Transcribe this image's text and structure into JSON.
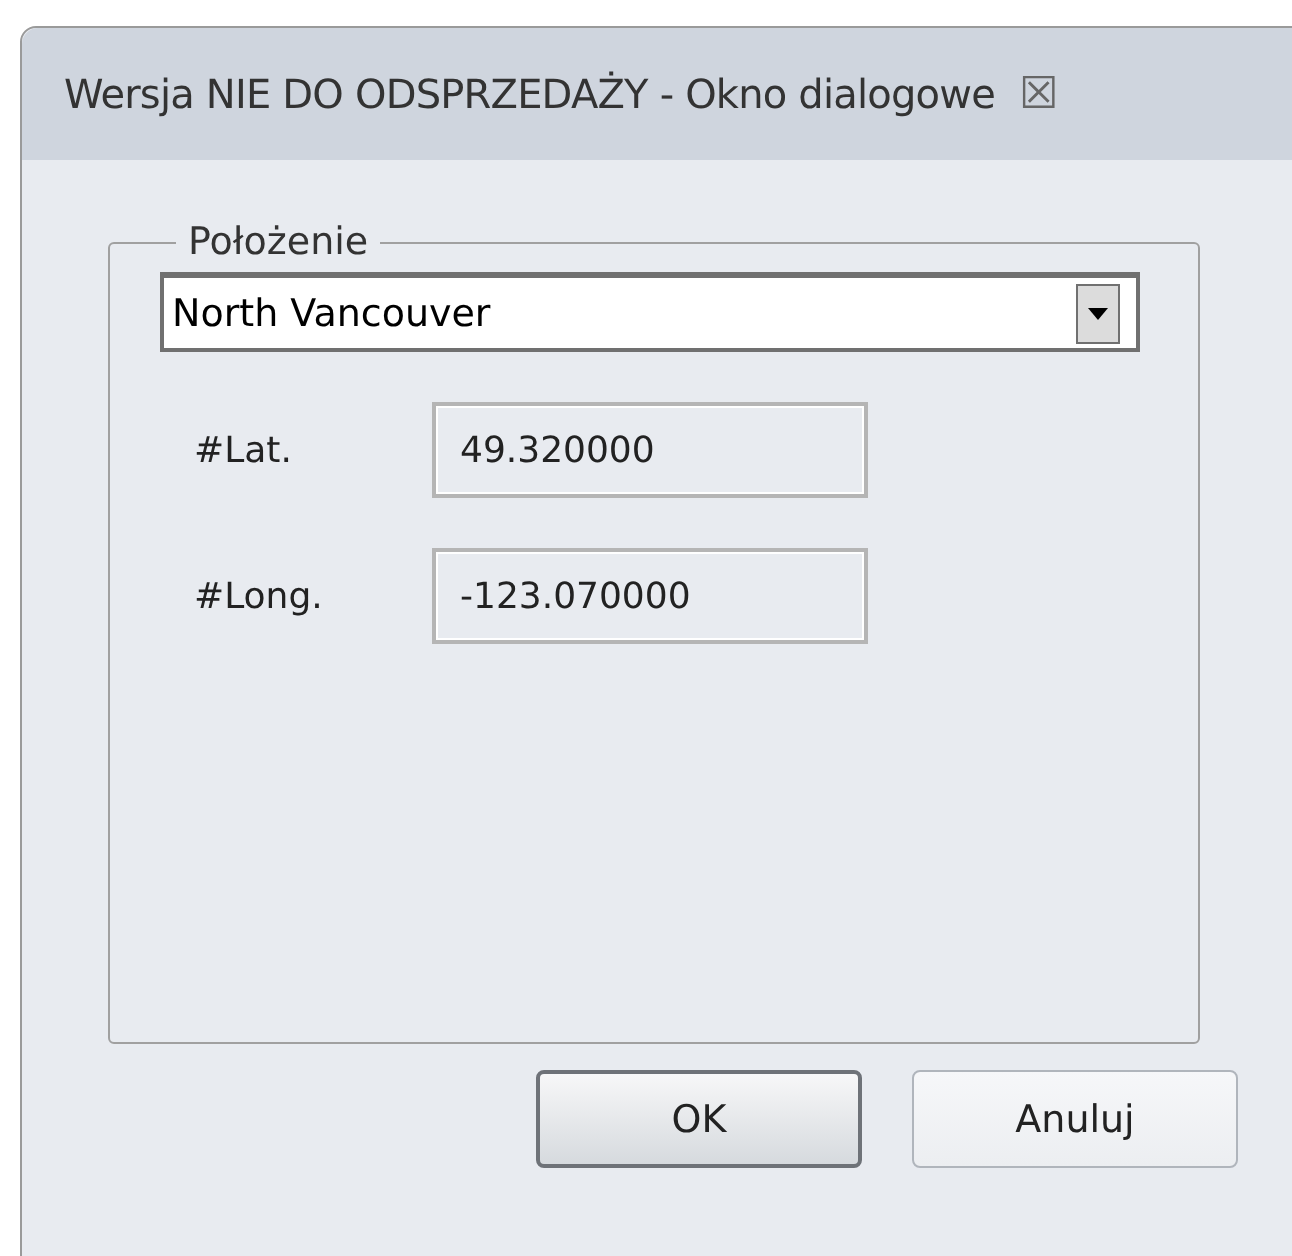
{
  "window": {
    "title": "Wersja NIE DO ODSPRZEDAŻY - Okno dialogowe",
    "close_glyph": "☒"
  },
  "group": {
    "legend": "Położenie",
    "location": {
      "value": "North Vancouver"
    },
    "fields": [
      {
        "label": "#Lat.",
        "value": "49.320000"
      },
      {
        "label": "#Long.",
        "value": "-123.070000"
      }
    ]
  },
  "buttons": [
    {
      "label": "OK",
      "default": true
    },
    {
      "label": "Anuluj",
      "default": false
    }
  ]
}
